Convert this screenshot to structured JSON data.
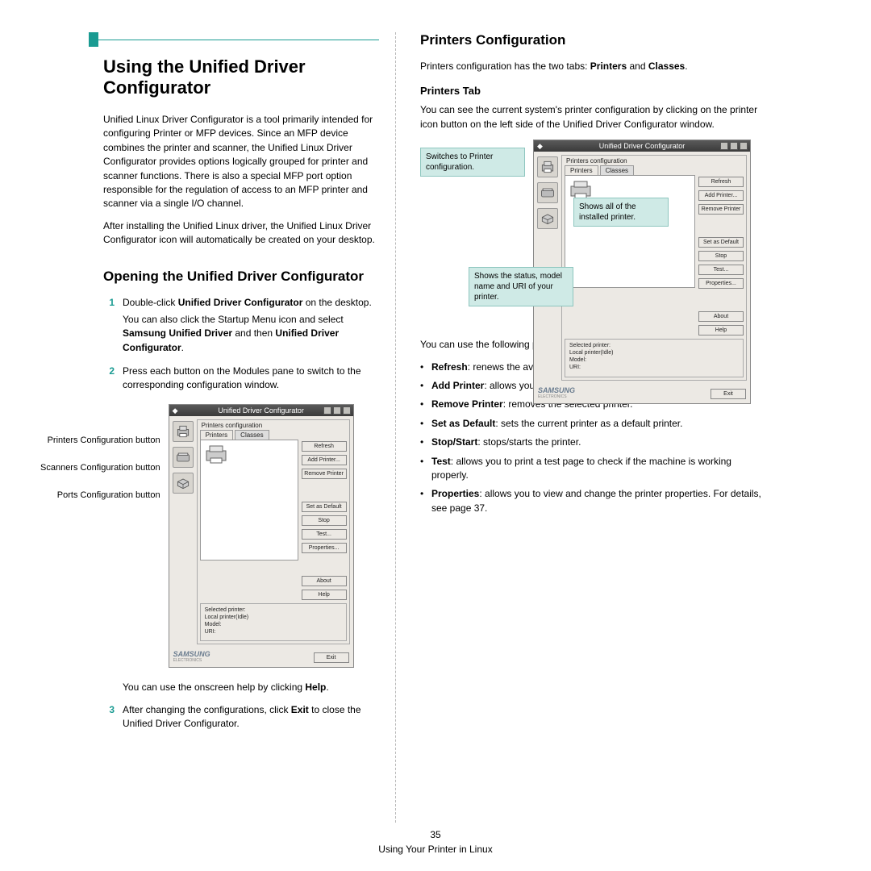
{
  "page_number": "35",
  "footer_text": "Using Your Printer in Linux",
  "left": {
    "title": "Using the Unified Driver Configurator",
    "intro_p1": "Unified Linux Driver Configurator is a tool primarily intended for configuring Printer or MFP devices. Since an MFP device combines the printer and scanner, the Unified Linux Driver Configurator provides options logically grouped for printer and scanner functions. There is also a special MFP port option responsible for the regulation of access to an MFP printer and scanner via a single I/O channel.",
    "intro_p2": "After installing the Unified Linux driver, the Unified Linux Driver Configurator icon will automatically be created on your desktop.",
    "h2": "Opening the Unified Driver Configurator",
    "steps": {
      "s1a_pre": "Double-click ",
      "s1a_b": "Unified Driver Configurator",
      "s1a_post": " on the desktop.",
      "s1b_pre": "You can also click the Startup Menu icon and select ",
      "s1b_b1": "Samsung Unified Driver",
      "s1b_mid": " and then ",
      "s1b_b2": "Unified Driver Configurator",
      "s1b_post": ".",
      "s2": "Press each button on the Modules pane to switch to the corresponding configuration window.",
      "fig_caption_help_pre": "You can use the onscreen help by clicking ",
      "fig_caption_help_b": "Help",
      "fig_caption_help_post": ".",
      "s3_pre": "After changing the configurations, click ",
      "s3_b": "Exit",
      "s3_post": " to close the Unified Driver Configurator."
    },
    "callouts": {
      "printers": "Printers Configuration button",
      "scanners": "Scanners Configuration button",
      "ports": "Ports Configuration button"
    },
    "dialog": {
      "title": "Unified Driver Configurator",
      "group_title": "Printers configuration",
      "tab_printers": "Printers",
      "tab_classes": "Classes",
      "btn_refresh": "Refresh",
      "btn_add": "Add Printer...",
      "btn_remove": "Remove Printer",
      "btn_default": "Set as Default",
      "btn_stop": "Stop",
      "btn_test": "Test...",
      "btn_props": "Properties...",
      "btn_about": "About",
      "btn_help": "Help",
      "sel_label": "Selected printer:",
      "sel_line1": "Local printer(Idle)",
      "sel_line2": "Model:",
      "sel_line3": "URI:",
      "logo": "SAMSUNG",
      "logo_sub": "ELECTRONICS",
      "exit": "Exit"
    }
  },
  "right": {
    "h2": "Printers Configuration",
    "p1_pre": "Printers configuration has the two tabs: ",
    "p1_b1": "Printers",
    "p1_mid": " and ",
    "p1_b2": "Classes",
    "p1_post": ".",
    "h3": "Printers Tab",
    "p2": "You can see the current system's printer configuration by clicking on the printer icon button on the left side of the Unified Driver Configurator window.",
    "callouts": {
      "c1": "Switches to Printer configuration.",
      "c2": "Shows all of the installed printer.",
      "c3": "Shows the status, model name and URI of your printer."
    },
    "p3": "You can use the following printer control buttons:",
    "bullets": {
      "b1_b": "Refresh",
      "b1_t": ": renews the available printers list.",
      "b2_b": "Add Printer",
      "b2_t": ": allows you to add a new printer.",
      "b3_b": "Remove Printer",
      "b3_t": ": removes the selected printer.",
      "b4_b": "Set as Default",
      "b4_t": ": sets the current printer as a default printer.",
      "b5_b": "Stop/Start",
      "b5_t": ": stops/starts the printer.",
      "b6_b": "Test",
      "b6_t": ": allows you to print a test page to check if the machine is working properly.",
      "b7_b": "Properties",
      "b7_t": ": allows you to view and change the printer properties. For details, see page 37."
    }
  }
}
